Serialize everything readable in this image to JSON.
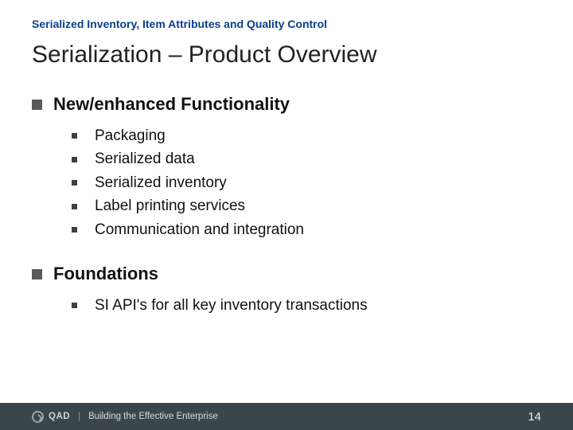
{
  "kicker": "Serialized Inventory, Item Attributes and Quality Control",
  "title": "Serialization – Product Overview",
  "sections": [
    {
      "heading": "New/enhanced Functionality",
      "items": [
        "Packaging",
        "Serialized data",
        "Serialized inventory",
        "Label printing services",
        "Communication and integration"
      ]
    },
    {
      "heading": "Foundations",
      "items": [
        "SI API's for all key inventory transactions"
      ]
    }
  ],
  "footer": {
    "brand": "QAD",
    "tagline": "Building the Effective Enterprise",
    "page_number": "14"
  }
}
